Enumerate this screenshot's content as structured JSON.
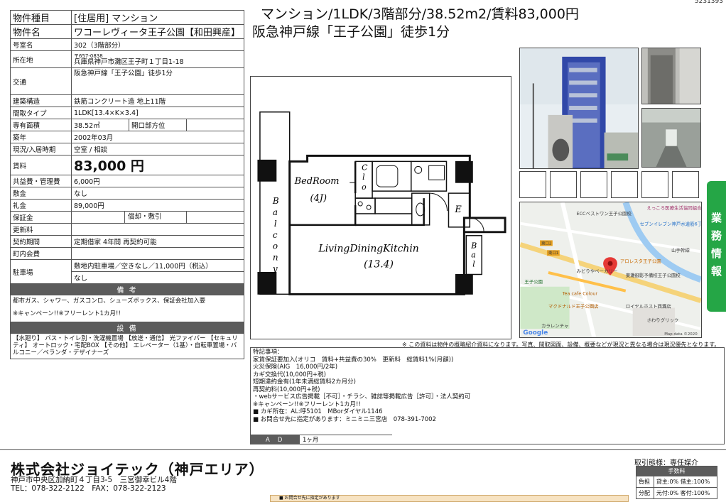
{
  "doc_id": "5231393",
  "headline": {
    "line1": "マンション/1LDK/3階部分/38.52m2/賃料83,000円",
    "line2": "阪急神戸線「王子公園」徒歩1分"
  },
  "spec": {
    "type_k": "物件種目",
    "type_v": "[住居用] マンション",
    "name_k": "物件名",
    "name_v": "ワコーレヴィータ王子公園【和田興産】",
    "room_k": "号室名",
    "room_v": "302（3階部分）",
    "addr_k": "所在地",
    "zip": "〒657-0838",
    "addr_v": "兵庫県神戸市灘区王子町１丁目1-18",
    "traffic_k": "交通",
    "traffic_v": "阪急神戸線「王子公園」徒歩1分",
    "struct_k": "建築構造",
    "struct_v": "鉄筋コンクリート造 地上11階",
    "layout_k": "間取タイプ",
    "layout_v": "1LDK[13.4×K×3.4]",
    "area_k": "専有面積",
    "area_v": "38.52㎡",
    "open_k": "開口部方位",
    "open_v": "",
    "built_k": "築年",
    "built_v": "2002年03月",
    "status_k": "現況/入居時期",
    "status_v": "空室 / 相談",
    "rent_k": "賃料",
    "rent_v": "83,000 円",
    "fee_k": "共益費・管理費",
    "fee_v": "6,000円",
    "deposit_k": "敷金",
    "deposit_v": "なし",
    "key_k": "礼金",
    "key_v": "89,000円",
    "guar_k": "保証金",
    "guar_v": "",
    "amort_k": "償却・敷引",
    "amort_v": "",
    "renew_k": "更新料",
    "renew_v": "",
    "contract_k": "契約期間",
    "contract_v": "定期借家 4年間 再契約可能",
    "assoc_k": "町内会費",
    "assoc_v": "",
    "parking_k": "駐車場",
    "parking_v1": "敷地内駐車場／空きなし／11,000円（税込）",
    "parking_v2": "なし",
    "remarks_title": "備 考",
    "remarks_1": "都市ガス、シャワー、ガスコンロ、シューズボックス、保証会社加入要",
    "remarks_2": "※キャンペーン!!※フリーレント1カ月!!",
    "equip_title": "設 備",
    "equip_text": "【水廻り】 バス・トイレ別・洗濯機置場 【放送・通信】 光ファイバー 【セキュリティ】 オートロック・宅配BOX 【その他】 エレベーター（1基）・自転車置場・バルコニー／ベランダ・デザイナーズ"
  },
  "plan": {
    "bedroom": "BedRoom",
    "bedroom_size": "(4J)",
    "clo": [
      "C",
      "l",
      "o"
    ],
    "balcony": [
      "B",
      "a",
      "l",
      "c",
      "o",
      "n",
      "y"
    ],
    "ldk": "LivingDiningKitchin",
    "ldk_size": "(13.4)",
    "entrance": "E",
    "bal2": [
      "B",
      "a",
      "l"
    ]
  },
  "map": {
    "labels": [
      "ECCベストワン王子公園校",
      "えっころ医療生活協同組合 灘診療所",
      "セブンイレブン神戸水道筋6丁目店",
      "東口2",
      "東口1",
      "アロレスタ王子公園",
      "山手幹線",
      "みどりやベーカリー",
      "東灘御影予備校王子公園校",
      "王子公園",
      "Tea cafe Colour",
      "マクドナルド王子公園店",
      "ロイヤルホスト西灘店",
      "カラレンチャ",
      "さわりグリック"
    ],
    "credit": "Map data ©2020"
  },
  "sidetab": [
    "業",
    "務",
    "情",
    "報"
  ],
  "note": "※ この資料は物件の概略紹介資料になります。写真、間取図面、設備、概要などが現況と異なる場合は現況優先となります。",
  "remarks_box": {
    "title": "特記事項：",
    "lines": [
      "家賃保証要加入(オリコ　賃料+共益費の30%　更新料　総賃料1%(月額))",
      "火災保険(AIG　16,000円/2年)",
      "カギ交換代(10,000円+税)",
      "短期違約金有(1年未満総賃料2カ月分)",
      "再契約料(10,000円+税)",
      "・webサービス広告掲載［不可］・チラシ、雑誌等掲載広告［許可］・法人契約可",
      "※キャンペーン!!※フリーレント1カ月!!",
      "■ カギ所在：AL:呼5101　MBorダイヤル1146",
      "■ お問合せ先に指定があります：ミニミニ三宮店　078-391-7002"
    ]
  },
  "ad": {
    "label": "Ａ Ｄ",
    "value": "1ヶ月"
  },
  "company": {
    "name": "株式会社ジョイテック（神戸エリア）",
    "address": "神戸市中央区加納町４丁目3-5　三宮御幸ビル4階",
    "tel": "TEL：078-322-2122　FAX：078-322-2123"
  },
  "contact_bar": "■ お問合せ先に指定があります",
  "deal": {
    "type": "取引態様：専任媒介",
    "fee_title": "手数料",
    "rows": [
      {
        "k": "負担",
        "v": "貸主:0% 借主:100%"
      },
      {
        "k": "分配",
        "v": "元付:0% 客付:100%"
      }
    ]
  }
}
